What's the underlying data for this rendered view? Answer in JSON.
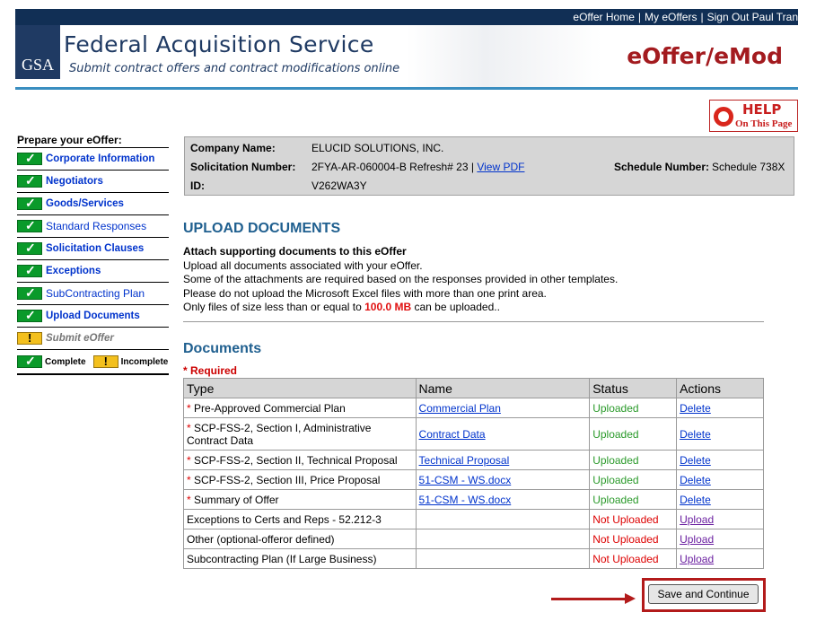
{
  "topnav": {
    "home": "eOffer Home",
    "my": "My eOffers",
    "signout": "Sign Out Paul Tran",
    "separator": "|"
  },
  "banner": {
    "logo": "GSA",
    "agency": "Federal Acquisition Service",
    "tagline": "Submit contract offers and contract modifications online",
    "product": "eOffer/eMod"
  },
  "help": {
    "big": "HELP",
    "small": "On This Page"
  },
  "sidebar": {
    "title": "Prepare your eOffer:",
    "items": [
      {
        "label": "Corporate Information",
        "status": "complete"
      },
      {
        "label": "Negotiators",
        "status": "complete"
      },
      {
        "label": "Goods/Services",
        "status": "complete"
      },
      {
        "label": "Standard Responses",
        "status": "complete"
      },
      {
        "label": "Solicitation Clauses",
        "status": "complete"
      },
      {
        "label": "Exceptions",
        "status": "complete"
      },
      {
        "label": "SubContracting Plan",
        "status": "complete"
      },
      {
        "label": "Upload Documents",
        "status": "complete"
      },
      {
        "label": "Submit eOffer",
        "status": "incomplete"
      }
    ],
    "legend": {
      "complete": "Complete",
      "incomplete": "Incomplete"
    }
  },
  "info": {
    "company_label": "Company Name:",
    "company": "ELUCID SOLUTIONS, INC.",
    "solicitation_label": "Solicitation Number:",
    "solicitation": "2FYA-AR-060004-B Refresh# 23 |",
    "view_pdf": "View PDF",
    "schedule_label": "Schedule Number:",
    "schedule": "Schedule 738X",
    "id_label": "ID:",
    "id": "V262WA3Y"
  },
  "upload": {
    "title": "UPLOAD DOCUMENTS",
    "heading": "Attach supporting documents to this eOffer",
    "line1": "Upload all documents associated with your eOffer.",
    "line2": "Some of the attachments are required based on the responses provided in other templates.",
    "line3": "Please do not upload the Microsoft Excel files with more than one print area.",
    "line4_pre": "Only files of size less than or equal to",
    "line4_size": "100.0 MB",
    "line4_post": "can be uploaded.."
  },
  "documents": {
    "title": "Documents",
    "required": "* Required",
    "columns": [
      "Type",
      "Name",
      "Status",
      "Actions"
    ],
    "rows": [
      {
        "required": "*",
        "type": "Pre-Approved Commercial Plan",
        "name": "Commercial Plan",
        "status": "Uploaded",
        "action": "Delete"
      },
      {
        "required": "*",
        "type": "SCP-FSS-2, Section I, Administrative Contract Data",
        "name": "Contract Data",
        "status": "Uploaded",
        "action": "Delete"
      },
      {
        "required": "*",
        "type": "SCP-FSS-2, Section II, Technical Proposal",
        "name": "Technical Proposal",
        "status": "Uploaded",
        "action": "Delete"
      },
      {
        "required": "*",
        "type": "SCP-FSS-2, Section III, Price Proposal",
        "name": "51-CSM - WS.docx",
        "status": "Uploaded",
        "action": "Delete"
      },
      {
        "required": "*",
        "type": "Summary of Offer",
        "name": "51-CSM - WS.docx",
        "status": "Uploaded",
        "action": "Delete"
      },
      {
        "required": "",
        "type": "Exceptions to Certs and Reps - 52.212-3",
        "name": "",
        "status": "Not Uploaded",
        "action": "Upload"
      },
      {
        "required": "",
        "type": "Other (optional-offeror defined)",
        "name": "",
        "status": "Not Uploaded",
        "action": "Upload"
      },
      {
        "required": "",
        "type": "Subcontracting Plan (If Large Business)",
        "name": "",
        "status": "Not Uploaded",
        "action": "Upload"
      }
    ]
  },
  "save_button": "Save and Continue",
  "colors": {
    "topbar": "#112f55",
    "brand_red": "#a31b1f",
    "heading_blue": "#1f5f8f",
    "uploaded_green": "#2a9a2a",
    "missing_red": "#dd0000"
  }
}
